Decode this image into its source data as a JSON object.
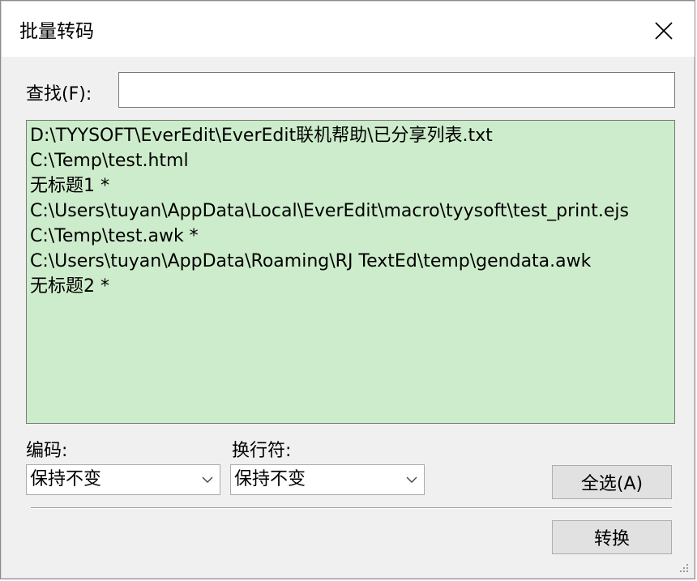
{
  "window": {
    "title": "批量转码",
    "close_icon": "close-icon"
  },
  "find": {
    "label": "查找(F):",
    "value": "",
    "placeholder": ""
  },
  "file_list": {
    "items": [
      "D:\\TYYSOFT\\EverEdit\\EverEdit联机帮助\\已分享列表.txt",
      "C:\\Temp\\test.html",
      "无标题1 *",
      "C:\\Users\\tuyan\\AppData\\Local\\EverEdit\\macro\\tyysoft\\test_print.ejs",
      "C:\\Temp\\test.awk *",
      "C:\\Users\\tuyan\\AppData\\Roaming\\RJ TextEd\\temp\\gendata.awk",
      "无标题2 *"
    ],
    "background_color": "#cdeccb"
  },
  "encoding": {
    "label": "编码:",
    "selected": "保持不变"
  },
  "line_ending": {
    "label": "换行符:",
    "selected": "保持不变"
  },
  "buttons": {
    "select_all": "全选(A)",
    "convert": "转换"
  },
  "icons": {
    "dropdown": "chevron-down-icon",
    "resize": "resize-grip-icon"
  }
}
